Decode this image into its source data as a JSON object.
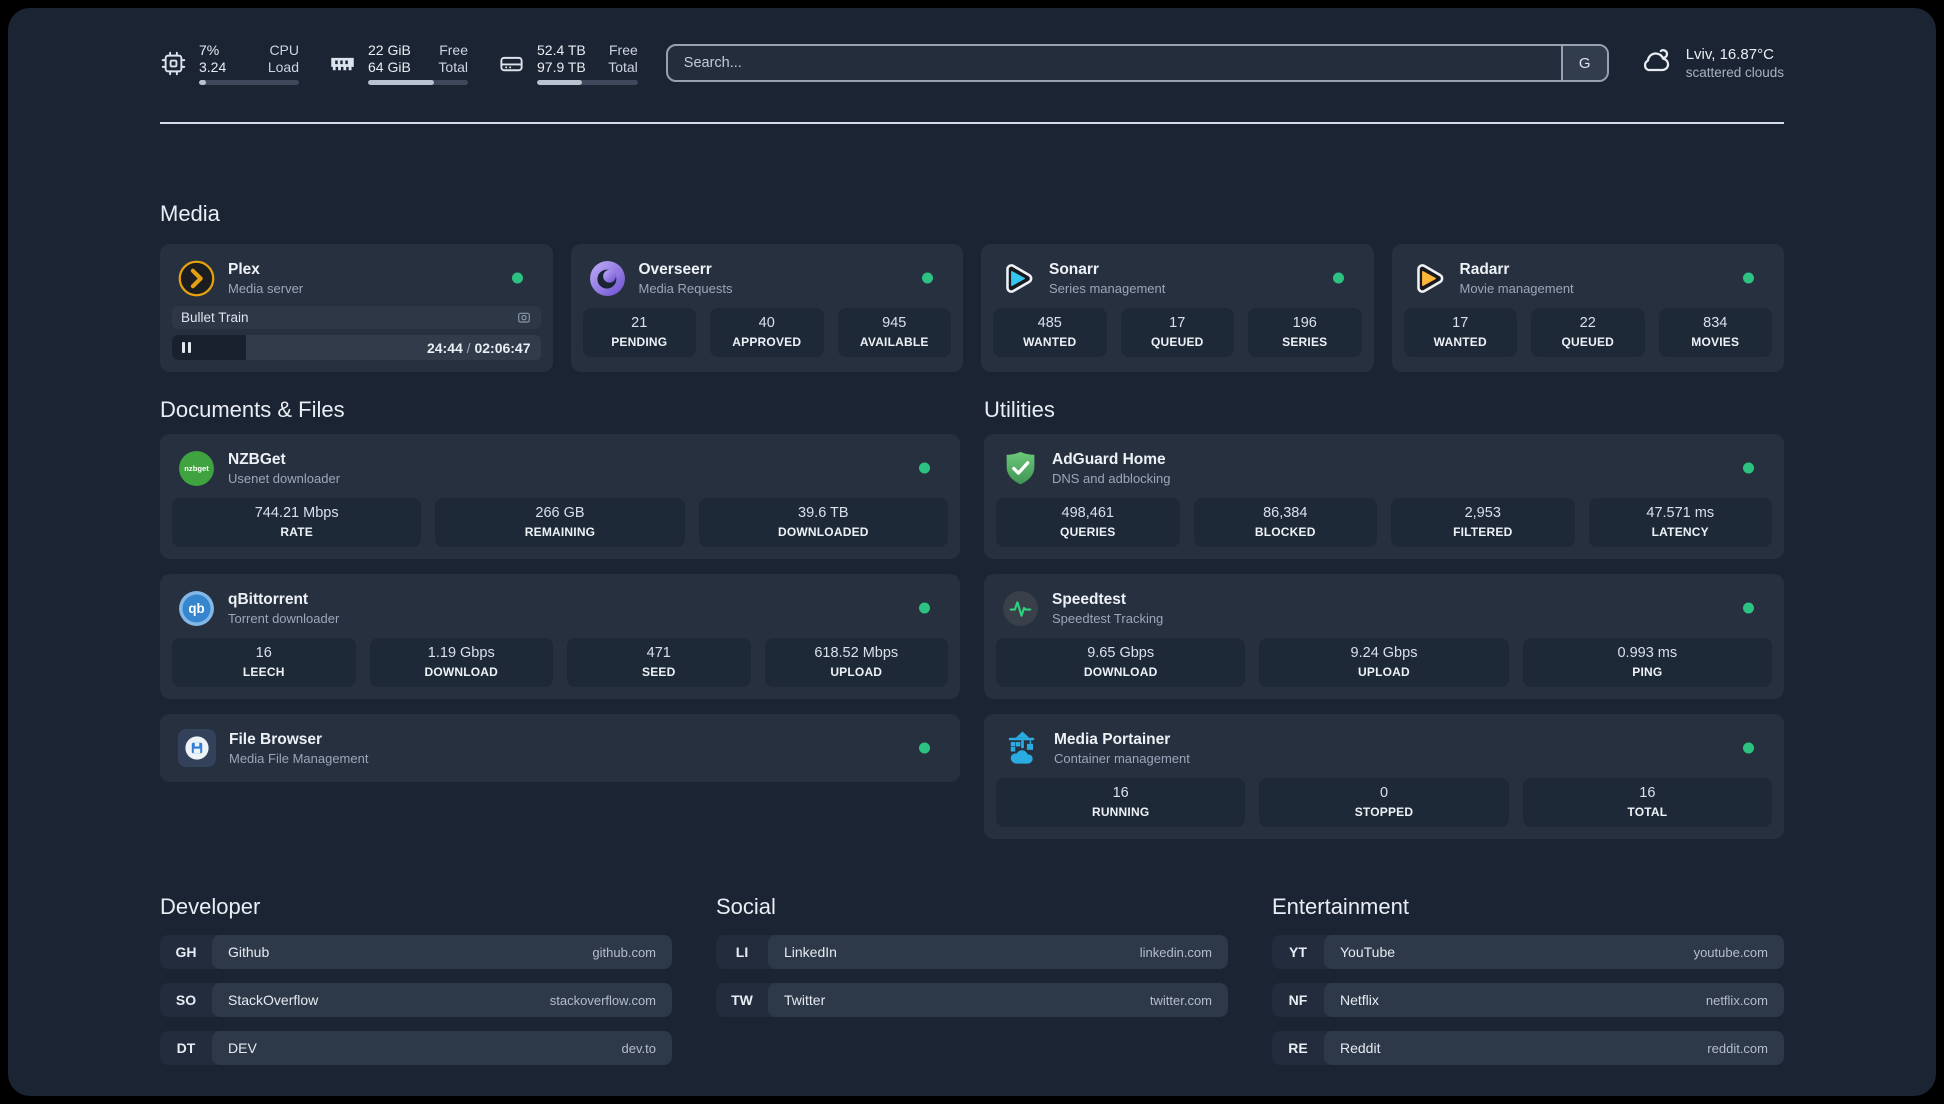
{
  "colors": {
    "background": "#1b2433",
    "card": "#26303f",
    "stat_block": "#1e2938",
    "status_green": "#2cc282",
    "plex_gold": "#e5a00d",
    "sonarr_blue": "#35c5f1",
    "radarr_gold": "#ffb43a",
    "nzbget_green": "#3fa33f",
    "qbittorrent_blue": "#3585cf",
    "adguard_green": "#57b569",
    "speedtest_green": "#2fd17c",
    "portainer_blue": "#2aabe2"
  },
  "topbar": {
    "resources": [
      {
        "icon": "cpu-icon",
        "values": [
          "7%",
          "3.24"
        ],
        "labels": [
          "CPU",
          "Load"
        ],
        "progress_pct": 7
      },
      {
        "icon": "memory-icon",
        "values": [
          "22 GiB",
          "64 GiB"
        ],
        "labels": [
          "Free",
          "Total"
        ],
        "progress_pct": 66
      },
      {
        "icon": "disk-icon",
        "values": [
          "52.4 TB",
          "97.9 TB"
        ],
        "labels": [
          "Free",
          "Total"
        ],
        "progress_pct": 45
      }
    ],
    "search": {
      "placeholder": "Search...",
      "provider": "G"
    },
    "weather": {
      "location": "Lviv, 16.87°C",
      "condition": "scattered clouds"
    }
  },
  "media": {
    "title": "Media",
    "plex": {
      "name": "Plex",
      "desc": "Media server",
      "now_playing": "Bullet Train",
      "position": "24:44",
      "sep": " / ",
      "duration": "02:06:47",
      "progress_pct": 20
    },
    "overseerr": {
      "name": "Overseerr",
      "desc": "Media Requests",
      "stats": [
        {
          "value": "21",
          "label": "PENDING"
        },
        {
          "value": "40",
          "label": "APPROVED"
        },
        {
          "value": "945",
          "label": "AVAILABLE"
        }
      ]
    },
    "sonarr": {
      "name": "Sonarr",
      "desc": "Series management",
      "stats": [
        {
          "value": "485",
          "label": "WANTED"
        },
        {
          "value": "17",
          "label": "QUEUED"
        },
        {
          "value": "196",
          "label": "SERIES"
        }
      ]
    },
    "radarr": {
      "name": "Radarr",
      "desc": "Movie management",
      "stats": [
        {
          "value": "17",
          "label": "WANTED"
        },
        {
          "value": "22",
          "label": "QUEUED"
        },
        {
          "value": "834",
          "label": "MOVIES"
        }
      ]
    }
  },
  "documents": {
    "title": "Documents & Files",
    "nzbget": {
      "name": "NZBGet",
      "desc": "Usenet downloader",
      "stats": [
        {
          "value": "744.21 Mbps",
          "label": "RATE"
        },
        {
          "value": "266 GB",
          "label": "REMAINING"
        },
        {
          "value": "39.6 TB",
          "label": "DOWNLOADED"
        }
      ]
    },
    "qbittorrent": {
      "name": "qBittorrent",
      "desc": "Torrent downloader",
      "stats": [
        {
          "value": "16",
          "label": "LEECH"
        },
        {
          "value": "1.19 Gbps",
          "label": "DOWNLOAD"
        },
        {
          "value": "471",
          "label": "SEED"
        },
        {
          "value": "618.52 Mbps",
          "label": "UPLOAD"
        }
      ]
    },
    "filebrowser": {
      "name": "File Browser",
      "desc": "Media File Management"
    }
  },
  "utilities": {
    "title": "Utilities",
    "adguard": {
      "name": "AdGuard Home",
      "desc": "DNS and adblocking",
      "stats": [
        {
          "value": "498,461",
          "label": "QUERIES"
        },
        {
          "value": "86,384",
          "label": "BLOCKED"
        },
        {
          "value": "2,953",
          "label": "FILTERED"
        },
        {
          "value": "47.571 ms",
          "label": "LATENCY"
        }
      ]
    },
    "speedtest": {
      "name": "Speedtest",
      "desc": "Speedtest Tracking",
      "stats": [
        {
          "value": "9.65 Gbps",
          "label": "DOWNLOAD"
        },
        {
          "value": "9.24 Gbps",
          "label": "UPLOAD"
        },
        {
          "value": "0.993 ms",
          "label": "PING"
        }
      ]
    },
    "portainer": {
      "name": "Media Portainer",
      "desc": "Container management",
      "stats": [
        {
          "value": "16",
          "label": "RUNNING"
        },
        {
          "value": "0",
          "label": "STOPPED"
        },
        {
          "value": "16",
          "label": "TOTAL"
        }
      ]
    }
  },
  "bookmarks": {
    "developer": {
      "title": "Developer",
      "items": [
        {
          "abbr": "GH",
          "name": "Github",
          "url": "github.com"
        },
        {
          "abbr": "SO",
          "name": "StackOverflow",
          "url": "stackoverflow.com"
        },
        {
          "abbr": "DT",
          "name": "DEV",
          "url": "dev.to"
        }
      ]
    },
    "social": {
      "title": "Social",
      "items": [
        {
          "abbr": "LI",
          "name": "LinkedIn",
          "url": "linkedin.com"
        },
        {
          "abbr": "TW",
          "name": "Twitter",
          "url": "twitter.com"
        }
      ]
    },
    "entertainment": {
      "title": "Entertainment",
      "items": [
        {
          "abbr": "YT",
          "name": "YouTube",
          "url": "youtube.com"
        },
        {
          "abbr": "NF",
          "name": "Netflix",
          "url": "netflix.com"
        },
        {
          "abbr": "RE",
          "name": "Reddit",
          "url": "reddit.com"
        }
      ]
    }
  }
}
